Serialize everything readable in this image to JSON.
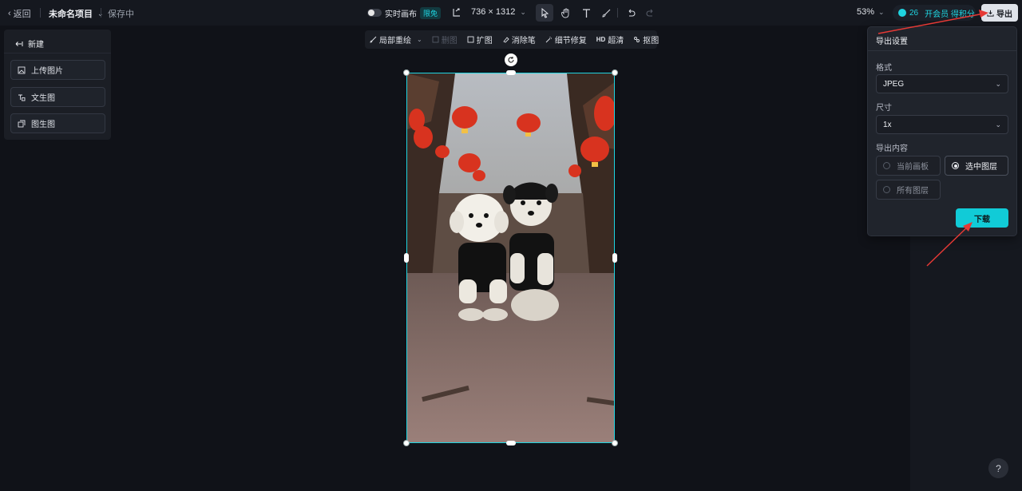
{
  "topbar": {
    "back_label": "返回",
    "project_name": "未命名项目",
    "save_status": "保存中",
    "realtime_label": "实时画布",
    "free_badge": "限免",
    "canvas_size": "736 × 1312",
    "zoom": "53%",
    "credits": "26",
    "vip_label": "开会员 得积分",
    "export_label": "导出"
  },
  "left_panel": {
    "new_label": "新建",
    "buttons": [
      {
        "label": "上传图片",
        "icon": "upload-image-icon"
      },
      {
        "label": "文生图",
        "icon": "text-to-image-icon"
      },
      {
        "label": "图生图",
        "icon": "image-to-image-icon"
      }
    ]
  },
  "subtoolbar": {
    "items": [
      {
        "label": "局部重绘",
        "enabled": true
      },
      {
        "label": "删图",
        "enabled": false
      },
      {
        "label": "扩图",
        "enabled": true
      },
      {
        "label": "消除笔",
        "enabled": true
      },
      {
        "label": "细节修复",
        "enabled": true
      },
      {
        "label": "超清",
        "prefix": "HD",
        "enabled": true
      },
      {
        "label": "抠图",
        "enabled": true
      }
    ]
  },
  "export_panel": {
    "title": "导出设置",
    "format_label": "格式",
    "format_value": "JPEG",
    "size_label": "尺寸",
    "size_value": "1x",
    "content_label": "导出内容",
    "options": {
      "current_board": "当前画板",
      "selected_layer": "选中图层",
      "all_layers": "所有图层"
    },
    "selected_option": "选中图层",
    "download_label": "下载"
  },
  "help_label": "?",
  "colors": {
    "accent": "#11cbd7",
    "arrow": "#e53935",
    "background": "#101218"
  }
}
